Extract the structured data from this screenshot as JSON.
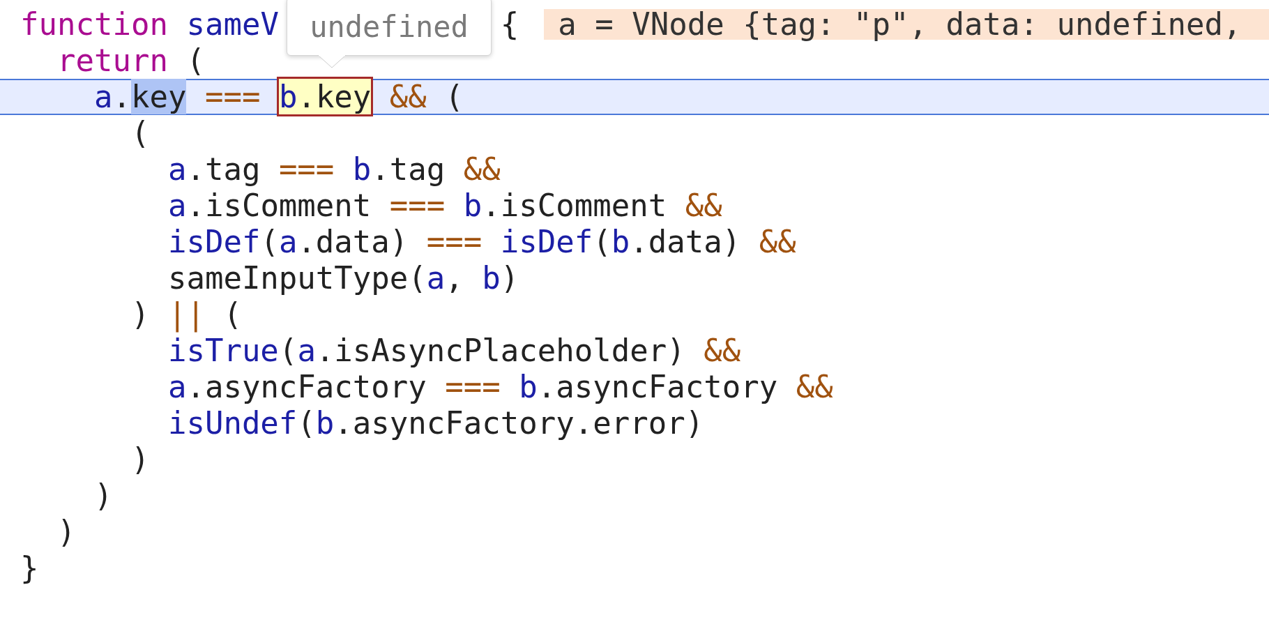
{
  "editor": {
    "lines": [
      {
        "selected": false,
        "tokens": [
          {
            "text": "function ",
            "kind": "keyword"
          },
          {
            "text": "sameV",
            "kind": "name"
          }
        ],
        "tail": "{",
        "inline_value": "a = VNode {tag: \"p\", data: undefined,",
        "children": [
          {
            "selected": false,
            "tokens": [
              {
                "text": "return",
                "kind": "keyword"
              },
              {
                "text": " (",
                "kind": "plain"
              }
            ],
            "children": [
              {
                "selected": true,
                "tokens": [
                  {
                    "text": "a",
                    "kind": "name",
                    "selected": false,
                    "hovered": false
                  },
                  {
                    "text": ".",
                    "kind": "plain",
                    "selected": false,
                    "hovered": false
                  },
                  {
                    "text": "key",
                    "kind": "plain",
                    "selected": true,
                    "hovered": false
                  },
                  {
                    "text": " === ",
                    "kind": "operator",
                    "selected": false,
                    "hovered": false
                  },
                  {
                    "text": "b",
                    "kind": "name",
                    "selected": false,
                    "hovered": true
                  },
                  {
                    "text": ".key",
                    "kind": "plain",
                    "selected": false,
                    "hovered": true
                  },
                  {
                    "text": " &&",
                    "kind": "operator",
                    "selected": false,
                    "hovered": false
                  },
                  {
                    "text": " (",
                    "kind": "plain",
                    "selected": false,
                    "hovered": false
                  }
                ],
                "children": [
                  {
                    "selected": false,
                    "tokens": [
                      {
                        "text": "(",
                        "kind": "plain"
                      }
                    ],
                    "children": [
                      {
                        "selected": false,
                        "tokens": [
                          {
                            "text": "a",
                            "kind": "name"
                          },
                          {
                            "text": ".tag ",
                            "kind": "plain"
                          },
                          {
                            "text": "=== ",
                            "kind": "operator"
                          },
                          {
                            "text": "b",
                            "kind": "name"
                          },
                          {
                            "text": ".tag ",
                            "kind": "plain"
                          },
                          {
                            "text": "&&",
                            "kind": "operator"
                          }
                        ]
                      },
                      {
                        "selected": false,
                        "tokens": [
                          {
                            "text": "a",
                            "kind": "name"
                          },
                          {
                            "text": ".isComment ",
                            "kind": "plain"
                          },
                          {
                            "text": "=== ",
                            "kind": "operator"
                          },
                          {
                            "text": "b",
                            "kind": "name"
                          },
                          {
                            "text": ".isComment ",
                            "kind": "plain"
                          },
                          {
                            "text": "&&",
                            "kind": "operator"
                          }
                        ]
                      },
                      {
                        "selected": false,
                        "tokens": [
                          {
                            "text": "isDef",
                            "kind": "name"
                          },
                          {
                            "text": "(",
                            "kind": "plain"
                          },
                          {
                            "text": "a",
                            "kind": "name"
                          },
                          {
                            "text": ".data) ",
                            "kind": "plain"
                          },
                          {
                            "text": "=== ",
                            "kind": "operator"
                          },
                          {
                            "text": "isDef",
                            "kind": "name"
                          },
                          {
                            "text": "(",
                            "kind": "plain"
                          },
                          {
                            "text": "b",
                            "kind": "name"
                          },
                          {
                            "text": ".data) ",
                            "kind": "plain"
                          },
                          {
                            "text": "&&",
                            "kind": "operator"
                          }
                        ]
                      },
                      {
                        "selected": false,
                        "tokens": [
                          {
                            "text": "sameInputType(",
                            "kind": "plain"
                          },
                          {
                            "text": "a",
                            "kind": "name"
                          },
                          {
                            "text": ", ",
                            "kind": "plain"
                          },
                          {
                            "text": "b",
                            "kind": "name"
                          },
                          {
                            "text": ")",
                            "kind": "plain"
                          }
                        ]
                      }
                    ]
                  },
                  {
                    "selected": false,
                    "tokens": [
                      {
                        "text": ") ",
                        "kind": "plain"
                      },
                      {
                        "text": "||",
                        "kind": "operator"
                      },
                      {
                        "text": " (",
                        "kind": "plain"
                      }
                    ],
                    "children": [
                      {
                        "selected": false,
                        "tokens": [
                          {
                            "text": "isTrue",
                            "kind": "name"
                          },
                          {
                            "text": "(",
                            "kind": "plain"
                          },
                          {
                            "text": "a",
                            "kind": "name"
                          },
                          {
                            "text": ".isAsyncPlaceholder) ",
                            "kind": "plain"
                          },
                          {
                            "text": "&&",
                            "kind": "operator"
                          }
                        ]
                      },
                      {
                        "selected": false,
                        "tokens": [
                          {
                            "text": "a",
                            "kind": "name"
                          },
                          {
                            "text": ".asyncFactory ",
                            "kind": "plain"
                          },
                          {
                            "text": "=== ",
                            "kind": "operator"
                          },
                          {
                            "text": "b",
                            "kind": "name"
                          },
                          {
                            "text": ".asyncFactory ",
                            "kind": "plain"
                          },
                          {
                            "text": "&&",
                            "kind": "operator"
                          }
                        ]
                      },
                      {
                        "selected": false,
                        "tokens": [
                          {
                            "text": "isUndef",
                            "kind": "name"
                          },
                          {
                            "text": "(",
                            "kind": "plain"
                          },
                          {
                            "text": "b",
                            "kind": "name"
                          },
                          {
                            "text": ".asyncFactory.error)",
                            "kind": "plain"
                          }
                        ]
                      }
                    ]
                  },
                  {
                    "selected": false,
                    "tokens": [
                      {
                        "text": ")",
                        "kind": "plain"
                      }
                    ]
                  }
                ]
              },
              {
                "selected": false,
                "tokens": [
                  {
                    "text": ")",
                    "kind": "plain"
                  }
                ]
              }
            ]
          },
          {
            "selected": false,
            "tokens": [
              {
                "text": ")",
                "kind": "plain"
              }
            ]
          }
        ]
      },
      {
        "selected": false,
        "tokens": [
          {
            "text": "}",
            "kind": "plain"
          }
        ]
      }
    ]
  },
  "tooltip": {
    "text": "undefined"
  }
}
